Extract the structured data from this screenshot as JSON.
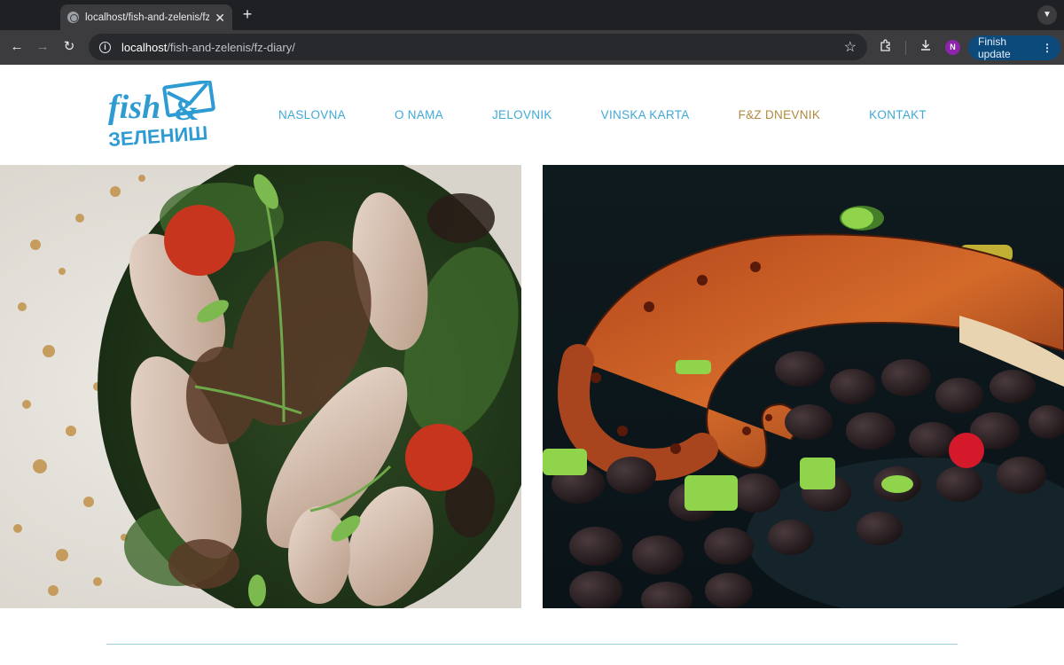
{
  "browser": {
    "tab_title": "localhost/fish-and-zelenis/fz-",
    "tab_close": "✕",
    "new_tab": "+",
    "url_host": "localhost",
    "url_path": "/fish-and-zelenis/fz-diary/",
    "profile_initial": "N",
    "finish_update_label": "Finish update",
    "menu_glyph": "⋮"
  },
  "site": {
    "logo_text_top": "fish",
    "logo_text_bottom": "ЗЕЛЕНИШ",
    "logo_ampersand": "&",
    "nav": [
      {
        "label": "NASLOVNA"
      },
      {
        "label": "O NAMA"
      },
      {
        "label": "JELOVNIK"
      },
      {
        "label": "VINSKA KARTA"
      },
      {
        "label": "F&Z DNEVNIK",
        "active": true
      },
      {
        "label": "KONTAKT"
      }
    ]
  },
  "colors": {
    "nav_link": "#3fa9d6",
    "nav_active": "#b08a3e",
    "logo_blue": "#2f9bd3",
    "divider": "#9ccfe6"
  },
  "icons": {
    "back": "arrow-left-icon",
    "forward": "arrow-right-icon",
    "reload": "reload-icon",
    "site_info": "info-icon",
    "bookmark": "star-icon",
    "extensions": "puzzle-icon",
    "downloads": "download-icon",
    "tab_search": "chevron-down-icon"
  }
}
